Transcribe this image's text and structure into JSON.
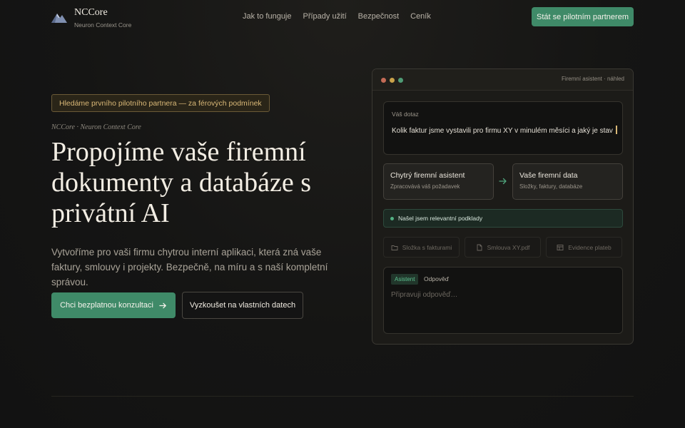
{
  "header": {
    "brand_name": "NCCore",
    "brand_subtitle": "Neuron Context Core",
    "nav": [
      "Jak to funguje",
      "Případy užití",
      "Bezpečnost",
      "Ceník"
    ],
    "cta": "Stát se pilotním partnerem"
  },
  "hero": {
    "badge": "Hledáme prvního pilotního partnera — za férových podmínek",
    "eyebrow": "NCCore · Neuron Context Core",
    "title": "Propojíme vaše firemní dokumenty a databáze s privátní AI",
    "description": "Vytvoříme pro vaši firmu chytrou interní aplikaci, která zná vaše faktury, smlouvy i projekty. Bezpečně, na míru a s naší kompletní správou.",
    "primary_button": "Chci bezplatnou konzultaci",
    "secondary_button": "Vyzkoušet na vlastních datech"
  },
  "preview": {
    "window_title": "Firemní asistent · náhled",
    "query_label": "Váš dotaz",
    "query_text": "Kolik faktur jsme vystavili pro firmu XY v minulém měsíci a jaký je stav",
    "card_assistant": {
      "title": "Chytrý firemní asistent",
      "subtitle": "Zpracovává váš požadavek"
    },
    "card_data": {
      "title": "Vaše firemní data",
      "subtitle": "Složky, faktury, databáze"
    },
    "found_text": "Našel jsem relevantní podklady",
    "sources": [
      {
        "label": "Složka s fakturami",
        "icon": "folder-icon"
      },
      {
        "label": "Smlouva XY.pdf",
        "icon": "document-icon"
      },
      {
        "label": "Evidence plateb",
        "icon": "table-icon"
      }
    ],
    "answer_tag": "Asistent",
    "answer_label": "Odpověď",
    "answer_placeholder": "Připravuji odpověď…"
  },
  "colors": {
    "accent_green": "#3f8a68",
    "badge_gold": "#d9b877",
    "background": "#151514"
  }
}
